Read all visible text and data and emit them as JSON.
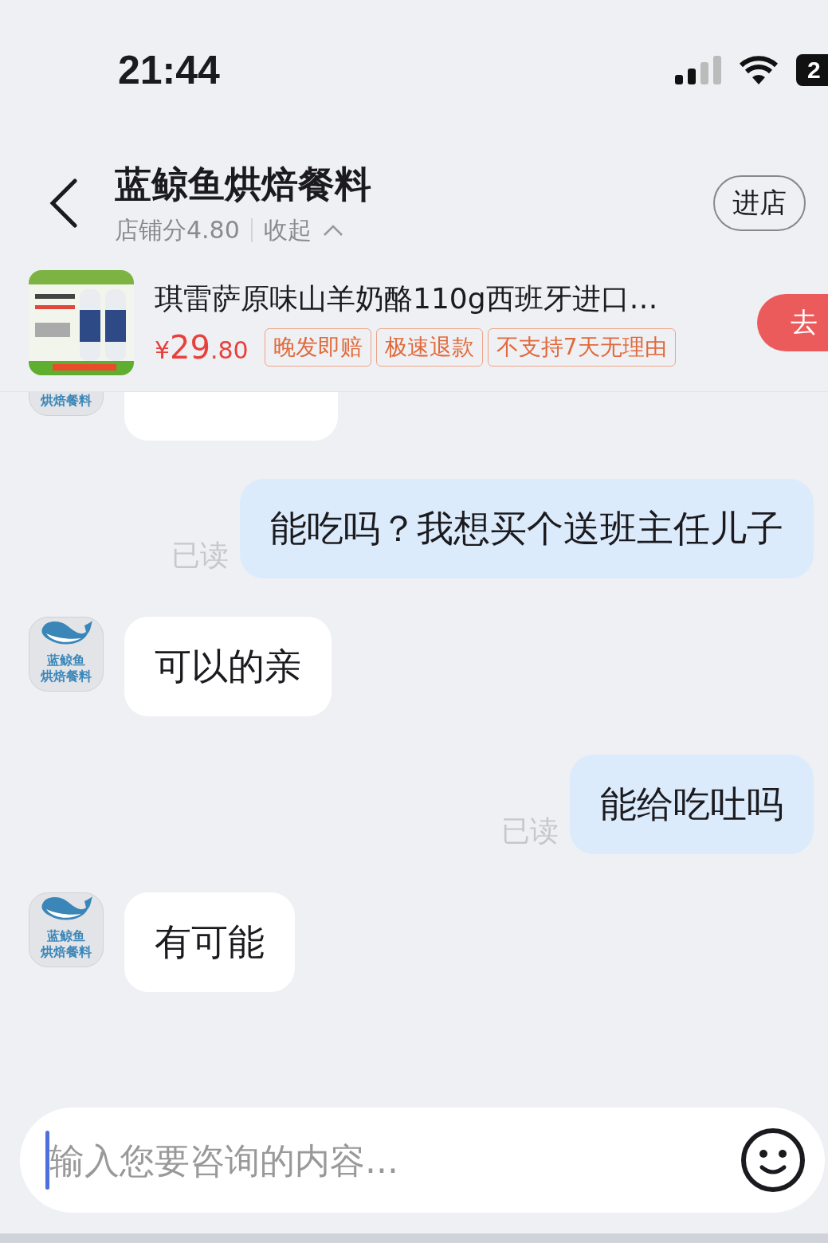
{
  "status_bar": {
    "time": "21:44",
    "battery": "2"
  },
  "header": {
    "title": "蓝鲸鱼烘焙餐料",
    "score": "店铺分4.80",
    "collapse": "收起",
    "enter_button": "进店"
  },
  "product": {
    "title": "琪雷萨原味山羊奶酪110g西班牙进口…",
    "price_symbol": "¥",
    "price_int": "29",
    "price_dec": ".80",
    "tags": [
      "晚发即赔",
      "极速退款",
      "不支持7天无理由"
    ],
    "buy_button": "去"
  },
  "messages": [
    {
      "kind": "received",
      "cut": true,
      "avatar_lines": [
        "烘焙餐料"
      ]
    },
    {
      "kind": "sent",
      "text": "能吃吗？我想买个送班主任儿子",
      "read": "已读"
    },
    {
      "kind": "received",
      "text": "可以的亲",
      "cut": false,
      "avatar_lines": [
        "蓝鲸鱼",
        "烘焙餐料"
      ]
    },
    {
      "kind": "sent",
      "text": "能给吃吐吗",
      "read": "已读"
    },
    {
      "kind": "received",
      "text": "有可能",
      "cut": false,
      "avatar_lines": [
        "蓝鲸鱼",
        "烘焙餐料"
      ]
    }
  ],
  "input": {
    "placeholder": "输入您要咨询的内容..."
  }
}
